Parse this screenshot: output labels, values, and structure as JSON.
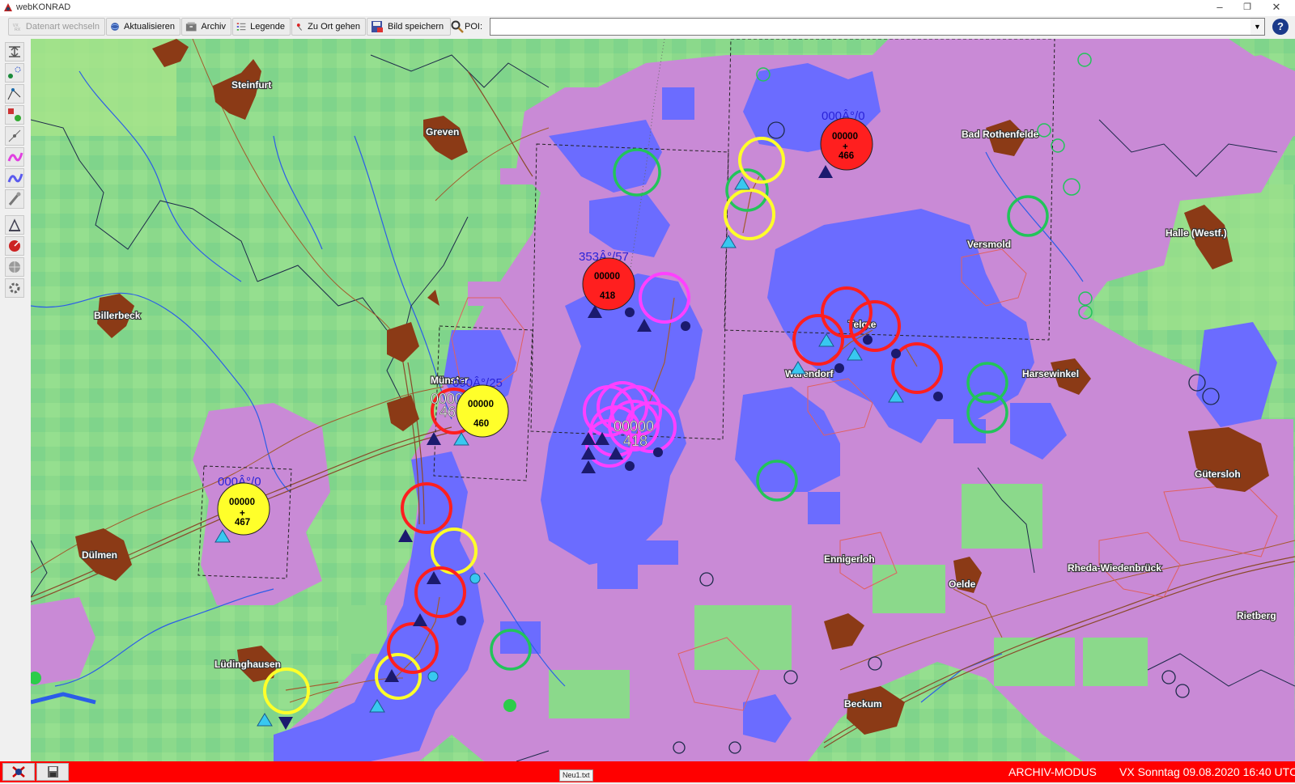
{
  "window": {
    "title": "webKONRAD"
  },
  "toolbar": {
    "datenart_label": "Datenart wechseln",
    "aktualisieren_label": "Aktualisieren",
    "archiv_label": "Archiv",
    "legende_label": "Legende",
    "zu_ort_label": "Zu Ort gehen",
    "bild_label": "Bild speichern",
    "poi_label": "POI:",
    "poi_value": "",
    "help_label": "?"
  },
  "left_tools": [
    "pan-tool-icon",
    "points-tool-icon",
    "polyline-tool-icon",
    "area-tool-icon",
    "track-tool-icon",
    "layer-magenta-icon",
    "layer-blue-icon",
    "probe-tool-icon",
    "measure-tool-icon",
    "radar-tool-icon",
    "globe-tool-icon",
    "settings-tool-icon"
  ],
  "map": {
    "places": [
      {
        "name": "Steinfurt"
      },
      {
        "name": "Greven"
      },
      {
        "name": "Bad Rothenfelde"
      },
      {
        "name": "Versmold"
      },
      {
        "name": "Halle (Westf.)"
      },
      {
        "name": "Billerbeck"
      },
      {
        "name": "Harsewinkel"
      },
      {
        "name": "Warendorf"
      },
      {
        "name": "Münster"
      },
      {
        "name": "Gütersloh"
      },
      {
        "name": "Dülmen"
      },
      {
        "name": "Ennigerloh"
      },
      {
        "name": "Oelde"
      },
      {
        "name": "Rheda-Wiedenbrück"
      },
      {
        "name": "Rietberg"
      },
      {
        "name": "Lüdinghausen"
      },
      {
        "name": "Beckum"
      },
      {
        "name": "Telgte"
      }
    ],
    "cells": [
      {
        "dir": "000Â°/0",
        "id": "00000",
        "num": "466",
        "plus": "+",
        "color": "#ff1f1f"
      },
      {
        "dir": "353Â°/57",
        "id": "00000",
        "num": "418",
        "plus": "",
        "color": "#ff1f1f"
      },
      {
        "dir": "090Â°/25",
        "id": "00000",
        "num": "460",
        "plus": "",
        "color": "#ffff2a"
      },
      {
        "dir": "000Â°/0",
        "id": "00000",
        "num": "467",
        "plus": "+",
        "color": "#ffff2a"
      },
      {
        "dir": "",
        "id": "00000",
        "num": "418",
        "plus": "",
        "color": "#ff40ff"
      },
      {
        "dir": "",
        "id": "0000",
        "num": "46",
        "plus": "",
        "color": "#ff1f1f"
      }
    ],
    "colors": {
      "land_green": "#8bd98b",
      "precip_violet": "#c98ad6",
      "precip_blue": "#6b6cff",
      "urban_brown": "#8b3a16",
      "storm_red": "#ff1f1f",
      "storm_yellow": "#ffff2a",
      "storm_green": "#22c45a",
      "storm_magenta": "#ff40ff"
    }
  },
  "status": {
    "file": "Neu1.txt",
    "mode": "ARCHIV-MODUS",
    "time": "VX  Sonntag  09.08.2020  16:40 UTC"
  }
}
